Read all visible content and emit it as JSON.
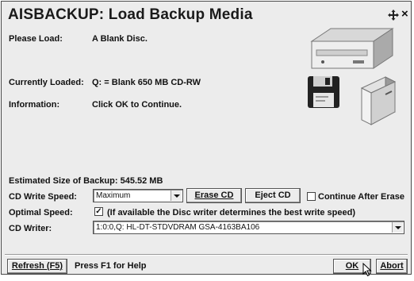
{
  "window": {
    "title": "AISBACKUP: Load Backup Media",
    "move_icon": "four-way-arrow-icon",
    "close_glyph": "×"
  },
  "info": {
    "please_load_label": "Please Load:",
    "please_load_value": "A Blank Disc.",
    "currently_loaded_label": "Currently Loaded:",
    "currently_loaded_value": "Q: = Blank 650 MB CD-RW",
    "information_label": "Information:",
    "information_value": "Click OK to Continue."
  },
  "backup": {
    "estimated_size": "Estimated Size of Backup: 545.52 MB",
    "cd_write_speed_label": "CD Write Speed:",
    "cd_write_speed_value": "Maximum",
    "erase_cd_label": "Erase CD",
    "eject_cd_label": "Eject CD",
    "continue_after_erase_label": "Continue After Erase",
    "continue_after_erase_checked": false,
    "optimal_speed_label": "Optimal Speed:",
    "optimal_speed_checked": true,
    "optimal_speed_text": "(If available the Disc writer determines the best write speed)",
    "cd_writer_label": "CD Writer:",
    "cd_writer_value": "1:0:0,Q: HL-DT-STDVDRAM GSA-4163BA106"
  },
  "footer": {
    "refresh_label": "Refresh (F5)",
    "help_text": "Press F1 for Help",
    "ok_label": "OK",
    "abort_label": "Abort"
  }
}
